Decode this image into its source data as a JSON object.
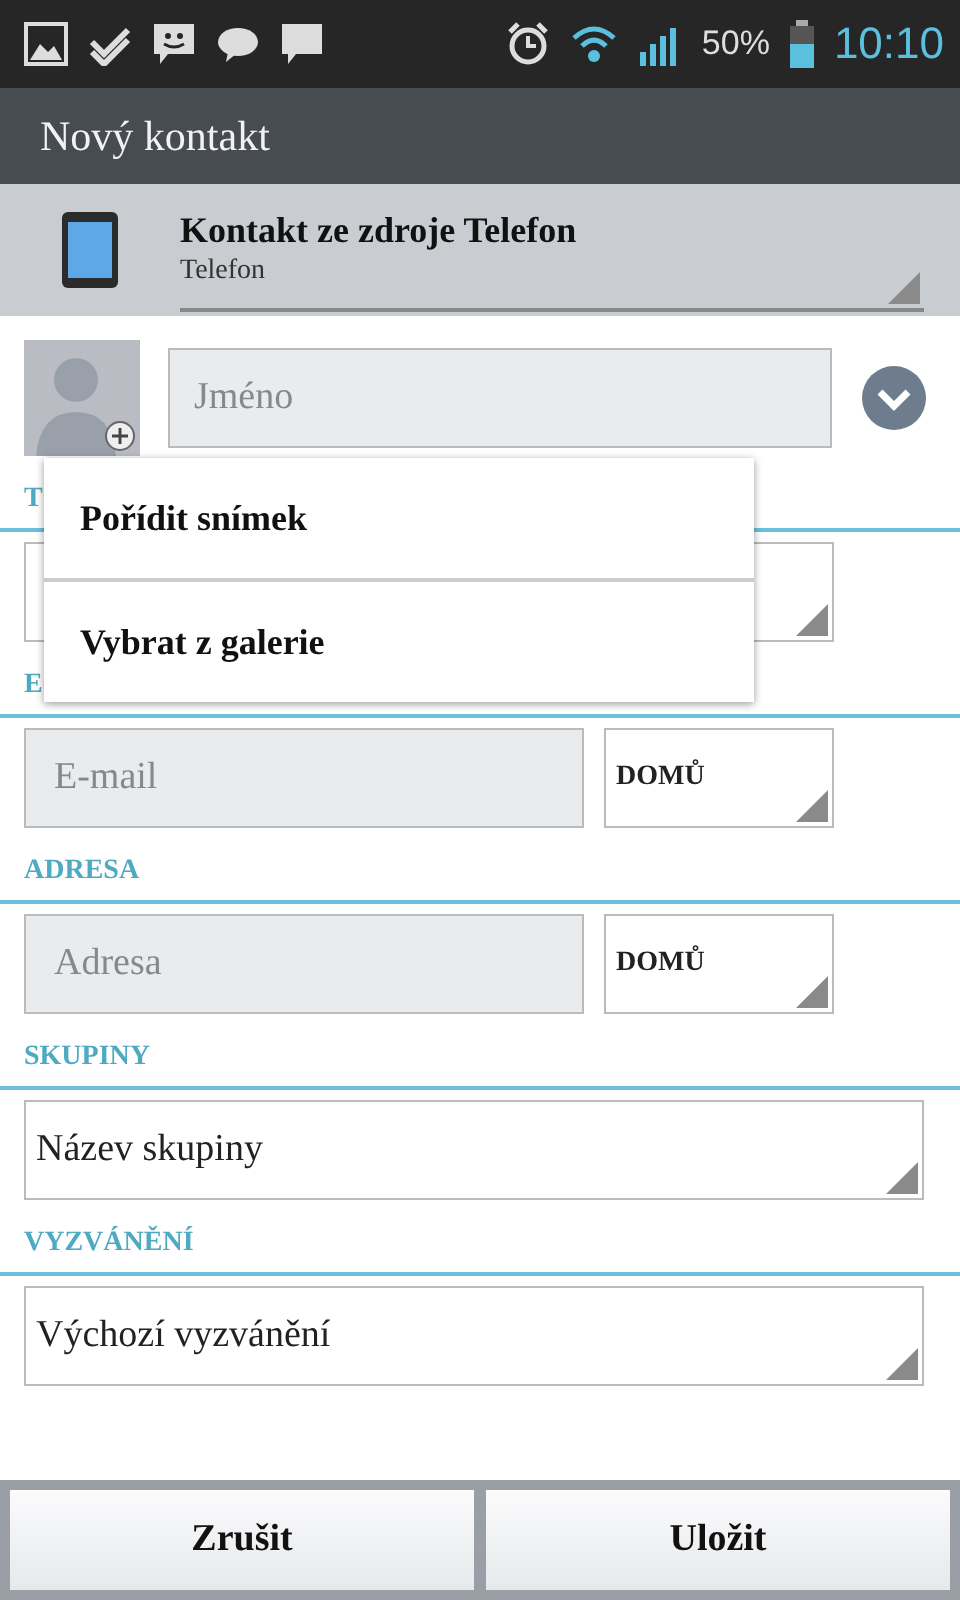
{
  "status_bar": {
    "battery": "50%",
    "time": "10:10"
  },
  "title": "Nový kontakt",
  "source": {
    "title": "Kontakt ze zdroje Telefon",
    "subtitle": "Telefon"
  },
  "name_field": {
    "placeholder": "Jméno"
  },
  "sections": [
    {
      "label": "T",
      "kind": "covered"
    },
    {
      "label": "E",
      "kind": "pair",
      "placeholder": "E-mail",
      "type": "DOMŮ"
    },
    {
      "label": "ADRESA",
      "kind": "pair",
      "placeholder": "Adresa",
      "type": "DOMŮ"
    },
    {
      "label": "SKUPINY",
      "kind": "select",
      "value": "Název skupiny"
    },
    {
      "label": "VYZVÁNĚNÍ",
      "kind": "select",
      "value": "Výchozí vyzvánění"
    }
  ],
  "menu": [
    "Pořídit snímek",
    "Vybrat z galerie"
  ],
  "buttons": [
    "Zrušit",
    "Uložit"
  ]
}
